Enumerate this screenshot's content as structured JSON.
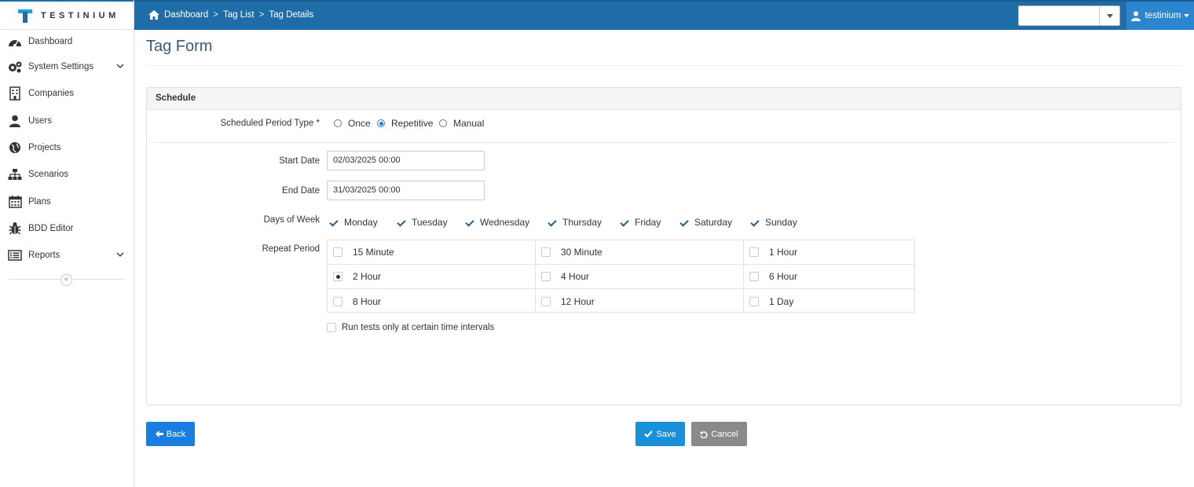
{
  "brand": {
    "name": "TESTINIUM"
  },
  "sidebar": {
    "items": [
      {
        "label": "Dashboard",
        "icon": "dashboard-icon"
      },
      {
        "label": "System Settings",
        "icon": "gears-icon",
        "expandable": true
      },
      {
        "label": "Companies",
        "icon": "building-icon"
      },
      {
        "label": "Users",
        "icon": "user-icon"
      },
      {
        "label": "Projects",
        "icon": "globe-icon"
      },
      {
        "label": "Scenarios",
        "icon": "sitemap-icon"
      },
      {
        "label": "Plans",
        "icon": "calendar-icon"
      },
      {
        "label": "BDD Editor",
        "icon": "bug-icon"
      },
      {
        "label": "Reports",
        "icon": "list-icon",
        "expandable": true
      }
    ],
    "collapse_label": "«"
  },
  "header": {
    "breadcrumb": [
      "Dashboard",
      "Tag List",
      "Tag Details"
    ],
    "select_value": "",
    "user_name": "testinium",
    "accent": "#1f6da8"
  },
  "page": {
    "title": "Tag Form"
  },
  "schedule": {
    "panel_title": "Schedule",
    "period_type_label": "Scheduled Period Type *",
    "period_types": [
      {
        "label": "Once",
        "selected": false
      },
      {
        "label": "Repetitive",
        "selected": true
      },
      {
        "label": "Manual",
        "selected": false
      }
    ],
    "start_date_label": "Start Date",
    "start_date_value": "02/03/2025 00:00",
    "end_date_label": "End Date",
    "end_date_value": "31/03/2025 00:00",
    "days_label": "Days of Week",
    "days": [
      {
        "label": "Monday",
        "checked": true
      },
      {
        "label": "Tuesday",
        "checked": true
      },
      {
        "label": "Wednesday",
        "checked": true
      },
      {
        "label": "Thursday",
        "checked": true
      },
      {
        "label": "Friday",
        "checked": true
      },
      {
        "label": "Saturday",
        "checked": true
      },
      {
        "label": "Sunday",
        "checked": true
      }
    ],
    "repeat_label": "Repeat Period",
    "repeat_options": [
      {
        "label": "15 Minute",
        "selected": false
      },
      {
        "label": "30 Minute",
        "selected": false
      },
      {
        "label": "1 Hour",
        "selected": false
      },
      {
        "label": "2 Hour",
        "selected": true
      },
      {
        "label": "4 Hour",
        "selected": false
      },
      {
        "label": "6 Hour",
        "selected": false
      },
      {
        "label": "8 Hour",
        "selected": false
      },
      {
        "label": "12 Hour",
        "selected": false
      },
      {
        "label": "1 Day",
        "selected": false
      }
    ],
    "run_only_label": "Run tests only at certain time intervals",
    "run_only_checked": false
  },
  "actions": {
    "back_label": "Back",
    "save_label": "Save",
    "cancel_label": "Cancel",
    "back_color": "#1a7ee0",
    "save_color": "#1a90d8",
    "cancel_color": "#8a8a8a"
  }
}
